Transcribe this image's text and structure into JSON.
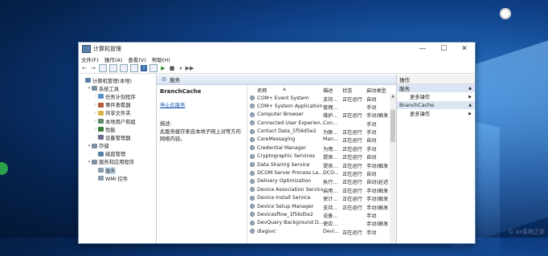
{
  "window": {
    "title": "计算机管理",
    "minimize": "—",
    "maximize": "☐",
    "close": "✕"
  },
  "menu": [
    "文件(F)",
    "操作(A)",
    "查看(V)",
    "帮助(H)"
  ],
  "toolbar": {
    "back": "←",
    "forward": "→",
    "help": "?",
    "play": "▶",
    "stop": "■",
    "pause": "⏸",
    "next": "▶▶"
  },
  "tree": [
    {
      "label": "计算机管理(本地)",
      "level": 0,
      "expander": "",
      "color": "#5a7fa8"
    },
    {
      "label": "系统工具",
      "level": 1,
      "expander": "▾",
      "color": "#7c8e9f"
    },
    {
      "label": "任务计划程序",
      "level": 2,
      "expander": "›",
      "color": "#5a8fc7"
    },
    {
      "label": "事件查看器",
      "level": 2,
      "expander": "›",
      "color": "#b55a3a"
    },
    {
      "label": "共享文件夹",
      "level": 2,
      "expander": "›",
      "color": "#d8b34a"
    },
    {
      "label": "本地用户和组",
      "level": 2,
      "expander": "›",
      "color": "#5d8a6a"
    },
    {
      "label": "性能",
      "level": 2,
      "expander": "›",
      "color": "#3b7d3b"
    },
    {
      "label": "设备管理器",
      "level": 2,
      "expander": "",
      "color": "#6a6a8e"
    },
    {
      "label": "存储",
      "level": 1,
      "expander": "▾",
      "color": "#7c8e9f"
    },
    {
      "label": "磁盘管理",
      "level": 2,
      "expander": "",
      "color": "#5a7fa8"
    },
    {
      "label": "服务和应用程序",
      "level": 1,
      "expander": "▾",
      "color": "#7c8e9f"
    },
    {
      "label": "服务",
      "level": 2,
      "expander": "",
      "color": "#8a9aad",
      "selected": true
    },
    {
      "label": "WMI 控件",
      "level": 2,
      "expander": "",
      "color": "#8a9aad"
    }
  ],
  "services_header": "服务",
  "detail": {
    "name": "BranchCache",
    "stop_link": "停止此服务",
    "desc_label": "描述:",
    "desc_text": "此服务缓存来自本地子网上对等方的网络内容。"
  },
  "columns": {
    "name": "名称",
    "desc": "描述",
    "status": "状态",
    "startup": "启动类型"
  },
  "services": [
    {
      "name": "COM+ Event System",
      "desc": "支持...",
      "status": "正在运行",
      "startup": "自动"
    },
    {
      "name": "COM+ System Application",
      "desc": "管理...",
      "status": "",
      "startup": "手动"
    },
    {
      "name": "Computer Browser",
      "desc": "维护...",
      "status": "正在运行",
      "startup": "手动(触发"
    },
    {
      "name": "Connected User Experien...",
      "desc": "Con...",
      "status": "",
      "startup": "手动"
    },
    {
      "name": "Contact Data_1f56d5e2",
      "desc": "为联...",
      "status": "正在运行",
      "startup": "手动"
    },
    {
      "name": "CoreMessaging",
      "desc": "Man...",
      "status": "正在运行",
      "startup": "自动"
    },
    {
      "name": "Credential Manager",
      "desc": "为用...",
      "status": "正在运行",
      "startup": "手动"
    },
    {
      "name": "Cryptographic Services",
      "desc": "提供...",
      "status": "正在运行",
      "startup": "自动"
    },
    {
      "name": "Data Sharing Service",
      "desc": "提供...",
      "status": "正在运行",
      "startup": "手动(触发"
    },
    {
      "name": "DCOM Server Process La...",
      "desc": "DCO...",
      "status": "正在运行",
      "startup": "自动"
    },
    {
      "name": "Delivery Optimization",
      "desc": "执行...",
      "status": "正在运行",
      "startup": "自动(延迟"
    },
    {
      "name": "Device Association Service",
      "desc": "启用...",
      "status": "正在运行",
      "startup": "手动(触发"
    },
    {
      "name": "Device Install Service",
      "desc": "使计...",
      "status": "正在运行",
      "startup": "手动(触发"
    },
    {
      "name": "Device Setup Manager",
      "desc": "支持...",
      "status": "正在运行",
      "startup": "手动(触发"
    },
    {
      "name": "Devicesflow_1f56d5e2",
      "desc": "设备...",
      "status": "",
      "startup": "手动"
    },
    {
      "name": "DevQuery Background D...",
      "desc": "使应...",
      "status": "",
      "startup": "手动(触发"
    },
    {
      "name": "diagsvc",
      "desc": "Devi...",
      "status": "正在运行",
      "startup": "手动"
    }
  ],
  "actions": {
    "header": "操作",
    "section1": "服务",
    "more1": "更多操作",
    "section2": "BranchCache",
    "more2": "更多操作",
    "arrow_up": "▲",
    "arrow_right": "▶"
  },
  "watermark": "© xx系统之家"
}
